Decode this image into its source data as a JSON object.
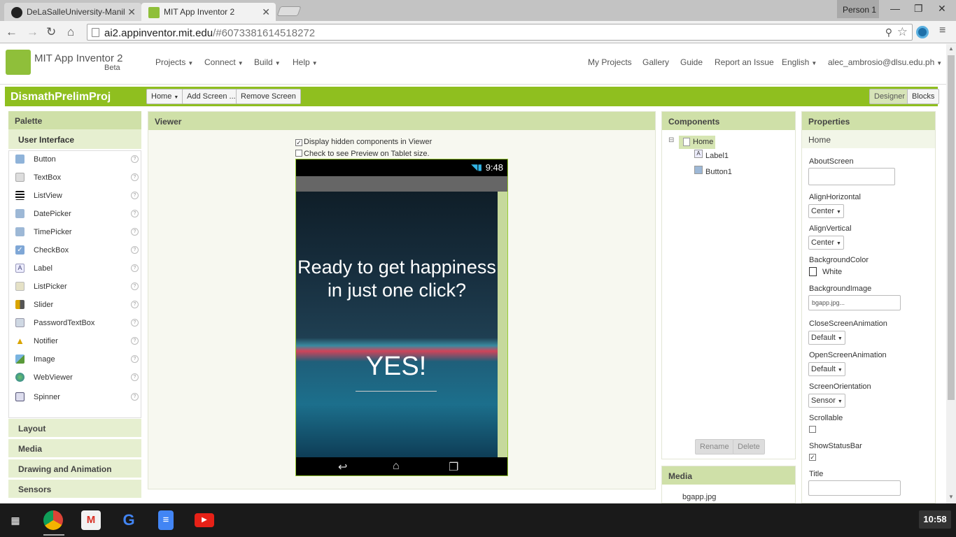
{
  "browser": {
    "tabs": [
      {
        "title": "DeLaSalleUniversity-Manil"
      },
      {
        "title": "MIT App Inventor 2"
      }
    ],
    "profile": "Person 1",
    "url_host": "ai2.appinventor.mit.edu",
    "url_path": "/#6073381614518272",
    "favicon_color_github": "#222222",
    "favicon_color_ai": "#8fbf3a"
  },
  "header": {
    "title": "MIT App Inventor 2",
    "beta": "Beta",
    "menus": [
      "Projects",
      "Connect",
      "Build",
      "Help"
    ],
    "links": [
      "My Projects",
      "Gallery",
      "Guide",
      "Report an Issue",
      "English",
      "alec_ambrosio@dlsu.edu.ph"
    ]
  },
  "project": {
    "name": "DismathPrelimProj",
    "screen_dropdown": "Home",
    "add_screen": "Add Screen ...",
    "remove_screen": "Remove Screen",
    "designer": "Designer",
    "blocks": "Blocks",
    "accent": "#8fbf1f"
  },
  "palette": {
    "title": "Palette",
    "section": "User Interface",
    "items": [
      "Button",
      "TextBox",
      "ListView",
      "DatePicker",
      "TimePicker",
      "CheckBox",
      "Label",
      "ListPicker",
      "Slider",
      "PasswordTextBox",
      "Notifier",
      "Image",
      "WebViewer",
      "Spinner"
    ],
    "categories": [
      "Layout",
      "Media",
      "Drawing and Animation",
      "Sensors"
    ]
  },
  "viewer": {
    "title": "Viewer",
    "check_hidden": "Display hidden components in Viewer",
    "check_tablet": "Check to see Preview on Tablet size.",
    "clock": "9:48",
    "label_text": "Ready to get happiness in just one click?",
    "button_text": "YES!"
  },
  "components": {
    "title": "Components",
    "root": "Home",
    "children": [
      "Label1",
      "Button1"
    ],
    "rename": "Rename",
    "delete": "Delete"
  },
  "media": {
    "title": "Media",
    "files": [
      "bgapp.jpg"
    ]
  },
  "properties": {
    "title": "Properties",
    "subject": "Home",
    "about_label": "AboutScreen",
    "align_h_label": "AlignHorizontal",
    "align_h": "Center",
    "align_v_label": "AlignVertical",
    "align_v": "Center",
    "bgcolor_label": "BackgroundColor",
    "bgcolor": "White",
    "bgimage_label": "BackgroundImage",
    "bgimage": "bgapp.jpg...",
    "close_anim_label": "CloseScreenAnimation",
    "close_anim": "Default",
    "open_anim_label": "OpenScreenAnimation",
    "open_anim": "Default",
    "orientation_label": "ScreenOrientation",
    "orientation": "Sensor",
    "scrollable_label": "Scrollable",
    "statusbar_label": "ShowStatusBar",
    "title_label": "Title"
  },
  "taskbar": {
    "clock": "10:58"
  }
}
